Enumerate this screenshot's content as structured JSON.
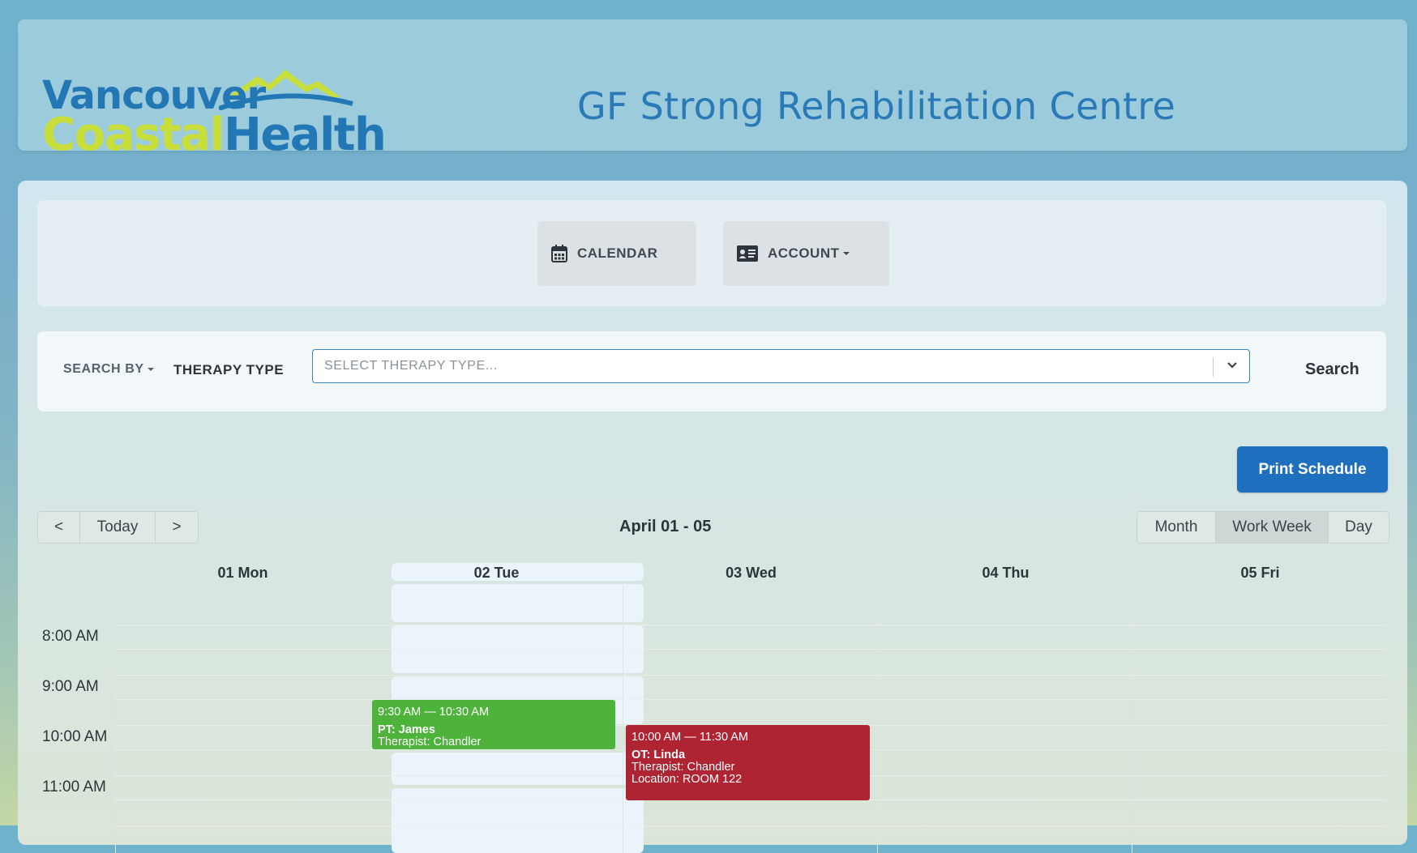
{
  "header": {
    "logo_line1": "Vancouver",
    "logo_line2a": "Coastal",
    "logo_line2b": "Health",
    "site_title": "GF Strong Rehabilitation Centre"
  },
  "nav": {
    "calendar_label": "CALENDAR",
    "account_label": "ACCOUNT"
  },
  "search": {
    "search_by_label": "SEARCH BY",
    "therapy_type_label": "THERAPY TYPE",
    "therapy_placeholder": "SELECT THERAPY TYPE...",
    "search_button": "Search"
  },
  "toolbar": {
    "print_label": "Print Schedule",
    "prev_label": "<",
    "today_label": "Today",
    "next_label": ">",
    "range_label": "April 01 - 05",
    "views": [
      "Month",
      "Work Week",
      "Day"
    ],
    "active_view": "Work Week"
  },
  "calendar": {
    "days": [
      "01 Mon",
      "02 Tue",
      "03 Wed",
      "04 Thu",
      "05 Fri"
    ],
    "times": [
      "8:00 AM",
      "9:00 AM",
      "10:00 AM",
      "11:00 AM"
    ],
    "events": [
      {
        "time": "9:30 AM — 10:30 AM",
        "title": "PT: James",
        "therapist": "Therapist: Chandler",
        "location": "",
        "color": "#4db33a"
      },
      {
        "time": "10:00 AM — 11:30 AM",
        "title": "OT: Linda",
        "therapist": "Therapist: Chandler",
        "location": "Location: ROOM 122",
        "color": "#ae2433"
      }
    ]
  },
  "colors": {
    "brand_blue": "#2377b5",
    "brand_green": "#c8df3b",
    "primary_button": "#1f6fbf"
  }
}
